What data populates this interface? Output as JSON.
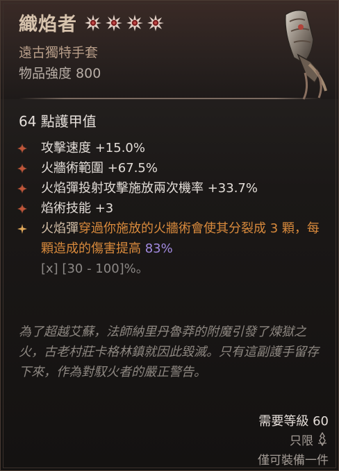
{
  "item": {
    "name": "織焰者",
    "stars": [
      1,
      2,
      3,
      4
    ],
    "type": "遠古獨特手套",
    "power": "物品強度 800",
    "icon": "gauntlet-icon"
  },
  "armor": "64 點護甲值",
  "affixes": [
    {
      "text": "攻擊速度 +15.0%"
    },
    {
      "text": "火牆術範圍 +67.5%"
    },
    {
      "text": "火焰彈投射攻擊施放兩次機率 +33.7%"
    },
    {
      "text": "焰術技能 +3"
    }
  ],
  "aspect": {
    "part1": "火焰彈",
    "part2": "穿過你施放的火牆術",
    "part3": "會使其分裂成 3 顆，每顆造成的傷害提高",
    "percent": "83%",
    "range": "[x] [30 - 100]%。"
  },
  "flavor": "為了超越艾蘇，法師納里丹魯莽的附魔引發了煉獄之火，古老村莊卡格林鎮就因此毀滅。只有這副護手留存下來，作為對馭火者的嚴正警告。",
  "requirements": {
    "level": "需要等級 60",
    "account_bound": "只限",
    "unique_equipped": "僅可裝備一件"
  },
  "colors": {
    "name": "#d7c3ad",
    "aspect_orange": "#d98a3c",
    "aspect_value": "#a28ae0",
    "star": "#e2d0c6"
  }
}
